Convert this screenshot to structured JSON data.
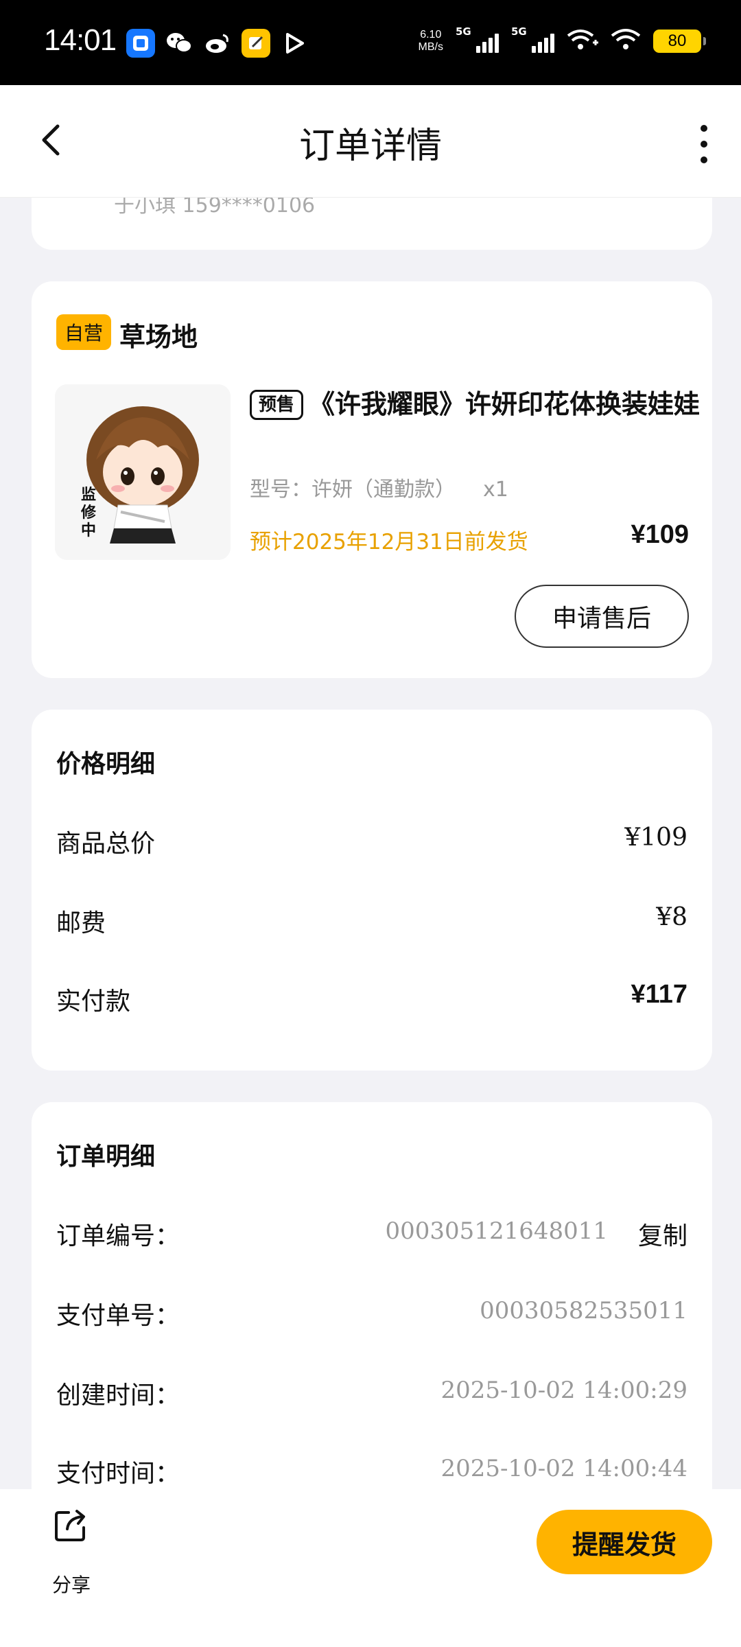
{
  "status_bar": {
    "time": "14:01",
    "speed_value": "6.10",
    "speed_unit": "MB/s",
    "signal1": "5G",
    "signal2": "5G",
    "battery": "80",
    "app_icons": [
      "alipay-icon",
      "wechat-icon",
      "weibo-icon",
      "note-app-icon",
      "play-icon"
    ]
  },
  "header": {
    "title": "订单详情"
  },
  "address": {
    "contact_partial": "于小琪 159****0106"
  },
  "store": {
    "badge": "自营",
    "name": "草场地",
    "product": {
      "presale_tag": "预售",
      "title": "《许我耀眼》许妍印花体换装娃娃",
      "spec_label": "型号：",
      "spec_value": "许妍（通勤款）",
      "quantity": "x1",
      "shipping_note": "预计2025年12月31日前发货",
      "price": "¥109",
      "image_text": "监修中"
    },
    "after_sale_label": "申请售后"
  },
  "price_detail": {
    "title": "价格明细",
    "rows": [
      {
        "label": "商品总价",
        "value": "¥109"
      },
      {
        "label": "邮费",
        "value": "¥8"
      },
      {
        "label": "实付款",
        "value": "¥117"
      }
    ]
  },
  "order_detail": {
    "title": "订单明细",
    "rows": [
      {
        "label": "订单编号：",
        "value": "000305121648011"
      },
      {
        "label": "支付单号：",
        "value": "00030582535011"
      },
      {
        "label": "创建时间：",
        "value": "2025-10-02 14:00:29"
      },
      {
        "label": "支付时间：",
        "value": "2025-10-02 14:00:44"
      }
    ],
    "copy_label": "复制"
  },
  "bottom_bar": {
    "share_label": "分享",
    "remind_label": "提醒发货"
  },
  "colors": {
    "accent": "#ffb300",
    "shipping_note": "#e8a100",
    "background": "#f2f2f6"
  }
}
